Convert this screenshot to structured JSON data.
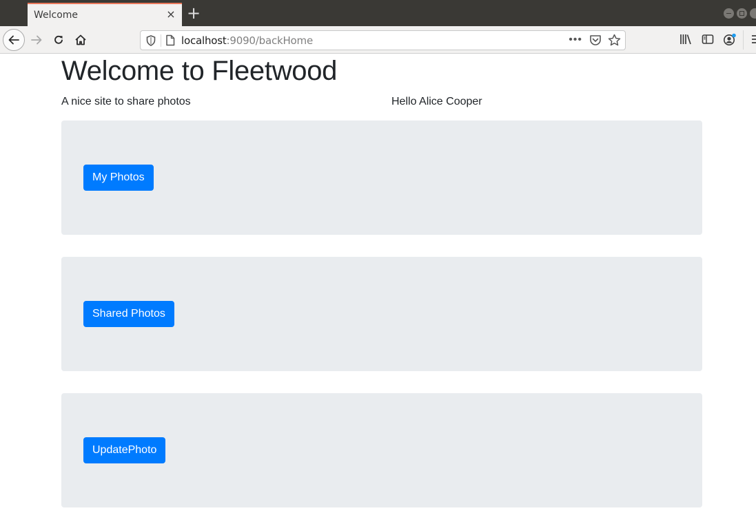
{
  "browser": {
    "tab": {
      "title": "Welcome",
      "close_glyph": "×"
    },
    "new_tab_glyph": "+",
    "address_bar": {
      "host": "localhost",
      "path": ":9090/backHome",
      "more_glyph": "•••"
    },
    "icons": {
      "back": "arrow-left-icon",
      "forward": "arrow-right-icon",
      "reload": "reload-icon",
      "home": "home-icon",
      "tracking_protection": "shield-icon",
      "page_info": "page-icon",
      "pocket": "pocket-icon",
      "bookmark": "star-icon",
      "library": "library-icon",
      "sidebar": "sidebar-icon",
      "account": "account-icon",
      "menu": "hamburger-menu-icon"
    },
    "colors": {
      "titlebar": "#3a3935",
      "tab_accent": "#e8775a",
      "account_badge": "#1f9cf0"
    }
  },
  "page": {
    "title": "Welcome to Fleetwood",
    "tagline": "A nice site to share photos",
    "greeting": "Hello Alice Cooper",
    "sections": [
      {
        "button_label": "My Photos"
      },
      {
        "button_label": "Shared Photos"
      },
      {
        "button_label": "UpdatePhoto"
      }
    ],
    "colors": {
      "primary": "#007bff",
      "jumbotron_bg": "#e9ecef",
      "text": "#212529"
    }
  }
}
